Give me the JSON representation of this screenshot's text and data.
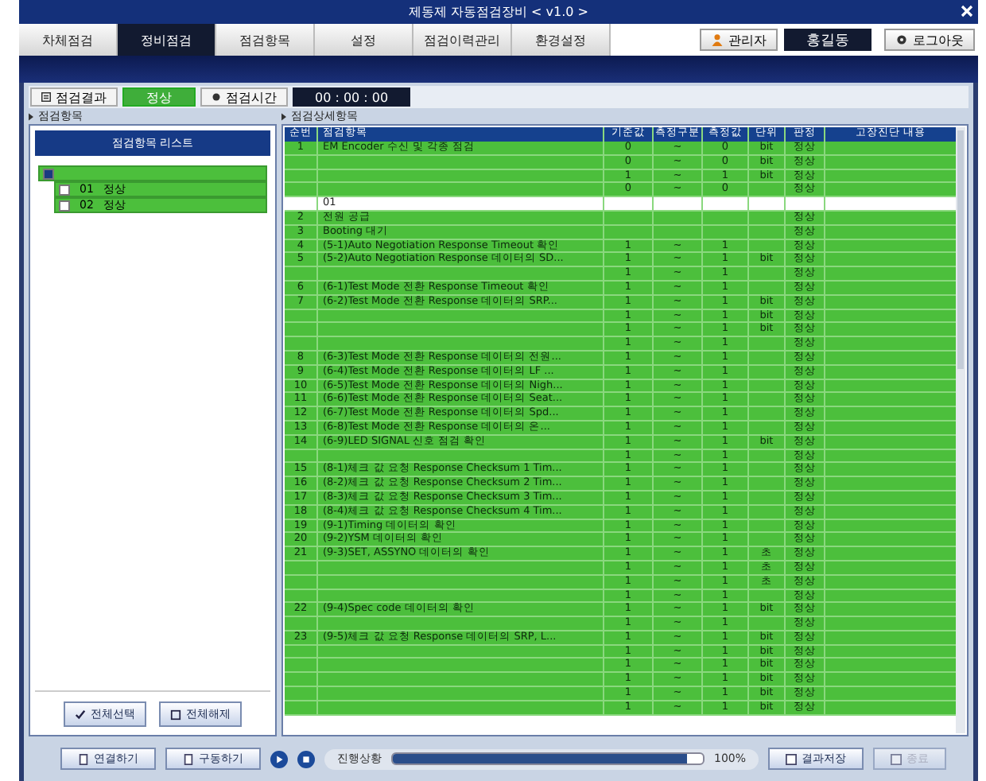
{
  "window": {
    "title": "제동제 자동점검장비 < v1.0 >"
  },
  "tabs": [
    {
      "label": "차체점검",
      "selected": false
    },
    {
      "label": "정비점검",
      "selected": true
    },
    {
      "label": "점검항목",
      "selected": false
    },
    {
      "label": "설정",
      "selected": false
    },
    {
      "label": "점검이력관리",
      "selected": false
    },
    {
      "label": "환경설정",
      "selected": false
    }
  ],
  "user": {
    "role_button": "관리자",
    "name": "홍길동",
    "logout_button": "로그아웃"
  },
  "status": {
    "result_label": "점검결과",
    "result": "정상",
    "time_label": "점검시간",
    "time": "00 : 00 : 00"
  },
  "left_panel": {
    "title": "점검항목",
    "list_title": "점검항목 리스트",
    "tree": [
      {
        "checked": true,
        "children": [
          {
            "label": "01",
            "status": "정상",
            "checked": false
          },
          {
            "label": "02",
            "status": "정상",
            "checked": false
          }
        ]
      }
    ],
    "buttons": [
      "전체선택",
      "전체해제"
    ]
  },
  "detail": {
    "title": "점검상세항목",
    "columns": [
      "순번",
      "점검항목",
      "기준값",
      "측정구분",
      "측정값",
      "단위",
      "판정",
      "고장진단 내용"
    ],
    "rows": [
      {
        "kind": "data",
        "no": "1",
        "item": "EM Encoder 수신 및 각종 점검",
        "ref": "0",
        "sep": "~",
        "value": "0",
        "unit": "bit",
        "result": "정상"
      },
      {
        "kind": "data",
        "ref": "0",
        "sep": "~",
        "value": "0",
        "unit": "bit",
        "result": "정상"
      },
      {
        "kind": "data",
        "ref": "1",
        "sep": "~",
        "value": "1",
        "unit": "bit",
        "result": "정상"
      },
      {
        "kind": "data",
        "ref": "0",
        "sep": "~",
        "value": "0",
        "result": "정상"
      },
      {
        "kind": "group",
        "item": "01"
      },
      {
        "kind": "data",
        "no": "2",
        "item": "전원 공급",
        "result": "정상"
      },
      {
        "kind": "data",
        "no": "3",
        "item": "Booting 대기",
        "result": "정상"
      },
      {
        "kind": "data",
        "no": "4",
        "item": "(5-1)Auto Negotiation Response Timeout 확인",
        "ref": "1",
        "sep": "~",
        "value": "1",
        "result": "정상"
      },
      {
        "kind": "data",
        "no": "5",
        "item": "(5-2)Auto Negotiation Response 데이터의 SD...",
        "ref": "1",
        "sep": "~",
        "value": "1",
        "unit": "bit",
        "result": "정상"
      },
      {
        "kind": "data",
        "ref": "1",
        "sep": "~",
        "value": "1",
        "result": "정상"
      },
      {
        "kind": "data",
        "no": "6",
        "item": "(6-1)Test Mode 전환 Response Timeout 확인",
        "ref": "1",
        "sep": "~",
        "value": "1",
        "result": "정상"
      },
      {
        "kind": "data",
        "no": "7",
        "item": "(6-2)Test Mode 전환 Response 데이터의 SRP...",
        "ref": "1",
        "sep": "~",
        "value": "1",
        "unit": "bit",
        "result": "정상"
      },
      {
        "kind": "data",
        "ref": "1",
        "sep": "~",
        "value": "1",
        "unit": "bit",
        "result": "정상"
      },
      {
        "kind": "data",
        "ref": "1",
        "sep": "~",
        "value": "1",
        "unit": "bit",
        "result": "정상"
      },
      {
        "kind": "data",
        "ref": "1",
        "sep": "~",
        "value": "1",
        "result": "정상"
      },
      {
        "kind": "data",
        "no": "8",
        "item": "(6-3)Test Mode 전환 Response 데이터의 전원...",
        "ref": "1",
        "sep": "~",
        "value": "1",
        "result": "정상"
      },
      {
        "kind": "data",
        "no": "9",
        "item": "(6-4)Test Mode 전환 Response 데이터의 LF ...",
        "ref": "1",
        "sep": "~",
        "value": "1",
        "result": "정상"
      },
      {
        "kind": "data",
        "no": "10",
        "item": "(6-5)Test Mode 전환 Response 데이터의 Nigh...",
        "ref": "1",
        "sep": "~",
        "value": "1",
        "result": "정상"
      },
      {
        "kind": "data",
        "no": "11",
        "item": "(6-6)Test Mode 전환 Response 데이터의 Seat...",
        "ref": "1",
        "sep": "~",
        "value": "1",
        "result": "정상"
      },
      {
        "kind": "data",
        "no": "12",
        "item": "(6-7)Test Mode 전환 Response 데이터의 Spd...",
        "ref": "1",
        "sep": "~",
        "value": "1",
        "result": "정상"
      },
      {
        "kind": "data",
        "no": "13",
        "item": "(6-8)Test Mode 전환 Response 데이터의 온...",
        "ref": "1",
        "sep": "~",
        "value": "1",
        "result": "정상"
      },
      {
        "kind": "data",
        "no": "14",
        "item": "(6-9)LED SIGNAL 신호 점검 확인",
        "ref": "1",
        "sep": "~",
        "value": "1",
        "unit": "bit",
        "result": "정상"
      },
      {
        "kind": "data",
        "ref": "1",
        "sep": "~",
        "value": "1",
        "result": "정상"
      },
      {
        "kind": "data",
        "no": "15",
        "item": "(8-1)체크 값 요청 Response Checksum 1 Tim...",
        "ref": "1",
        "sep": "~",
        "value": "1",
        "result": "정상"
      },
      {
        "kind": "data",
        "no": "16",
        "item": "(8-2)체크 값 요청 Response Checksum 2 Tim...",
        "ref": "1",
        "sep": "~",
        "value": "1",
        "result": "정상"
      },
      {
        "kind": "data",
        "no": "17",
        "item": "(8-3)체크 값 요청 Response Checksum 3 Tim...",
        "ref": "1",
        "sep": "~",
        "value": "1",
        "result": "정상"
      },
      {
        "kind": "data",
        "no": "18",
        "item": "(8-4)체크 값 요청 Response Checksum 4 Tim...",
        "ref": "1",
        "sep": "~",
        "value": "1",
        "result": "정상"
      },
      {
        "kind": "data",
        "no": "19",
        "item": "(9-1)Timing 데이터의 확인",
        "ref": "1",
        "sep": "~",
        "value": "1",
        "result": "정상"
      },
      {
        "kind": "data",
        "no": "20",
        "item": "(9-2)YSM 데이터의 확인",
        "ref": "1",
        "sep": "~",
        "value": "1",
        "result": "정상"
      },
      {
        "kind": "data",
        "no": "21",
        "item": "(9-3)SET, ASSYNO 데이터의 확인",
        "ref": "1",
        "sep": "~",
        "value": "1",
        "unit": "초",
        "result": "정상"
      },
      {
        "kind": "data",
        "ref": "1",
        "sep": "~",
        "value": "1",
        "unit": "초",
        "result": "정상"
      },
      {
        "kind": "data",
        "ref": "1",
        "sep": "~",
        "value": "1",
        "unit": "초",
        "result": "정상"
      },
      {
        "kind": "data",
        "ref": "1",
        "sep": "~",
        "value": "1",
        "result": "정상"
      },
      {
        "kind": "data",
        "no": "22",
        "item": "(9-4)Spec code 데이터의 확인",
        "ref": "1",
        "sep": "~",
        "value": "1",
        "unit": "bit",
        "result": "정상"
      },
      {
        "kind": "data",
        "ref": "1",
        "sep": "~",
        "value": "1",
        "result": "정상"
      },
      {
        "kind": "data",
        "no": "23",
        "item": "(9-5)체크 값 요청 Response 데이터의 SRP, L...",
        "ref": "1",
        "sep": "~",
        "value": "1",
        "unit": "bit",
        "result": "정상"
      },
      {
        "kind": "data",
        "ref": "1",
        "sep": "~",
        "value": "1",
        "unit": "bit",
        "result": "정상"
      },
      {
        "kind": "data",
        "ref": "1",
        "sep": "~",
        "value": "1",
        "unit": "bit",
        "result": "정상"
      },
      {
        "kind": "data",
        "ref": "1",
        "sep": "~",
        "value": "1",
        "unit": "bit",
        "result": "정상"
      },
      {
        "kind": "data",
        "ref": "1",
        "sep": "~",
        "value": "1",
        "unit": "bit",
        "result": "정상"
      },
      {
        "kind": "data",
        "ref": "1",
        "sep": "~",
        "value": "1",
        "unit": "bit",
        "result": "정상"
      }
    ]
  },
  "footer": {
    "left_buttons": [
      "연결하기",
      "구동하기"
    ],
    "progress_label": "진행상황",
    "progress": {
      "level": 0.95,
      "reading": "100%"
    },
    "right_buttons": [
      {
        "label": "결과저장",
        "disabled": false
      },
      {
        "label": "종료",
        "disabled": true
      }
    ]
  }
}
